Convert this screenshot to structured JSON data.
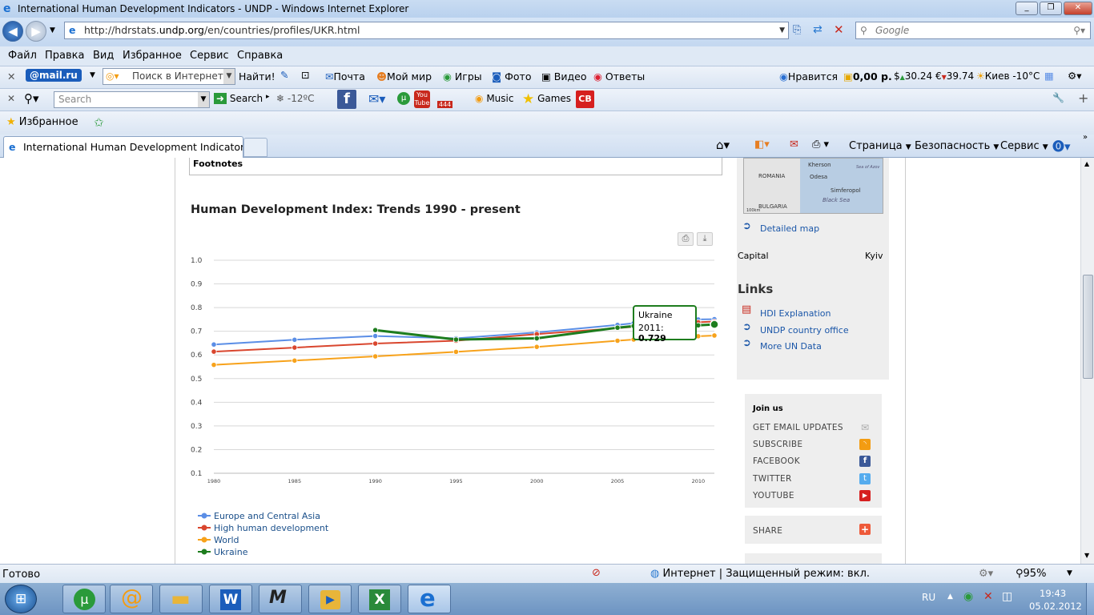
{
  "window": {
    "title": "International Human Development Indicators - UNDP - Windows Internet Explorer"
  },
  "address": {
    "url_prefix": "http://hdrstats.",
    "url_domain": "undp.org",
    "url_path": "/en/countries/profiles/UKR.html",
    "search_placeholder": "Google"
  },
  "menu": [
    "Файл",
    "Правка",
    "Вид",
    "Избранное",
    "Сервис",
    "Справка"
  ],
  "toolbar1": {
    "mailru": "@mail.ru",
    "search_placeholder": "Поиск в Интернете",
    "find": "Найти!",
    "mail": "Почта",
    "myworld": "Мой мир",
    "games": "Игры",
    "photo": "Фото",
    "video": "Видео",
    "answers": "Ответы",
    "like": "Нравится",
    "balance": "0,00 р.",
    "usd": "30.24",
    "eur": "39.74",
    "weather": "Киев -10°C"
  },
  "toolbar2": {
    "search_placeholder": "Search",
    "search_btn": "Search",
    "temp": "-12ºC",
    "badge": "444",
    "music": "Music",
    "games": "Games",
    "cb": "CB"
  },
  "favorites": {
    "label": "Избранное"
  },
  "tab": {
    "title": "International Human Development Indicators..."
  },
  "cmdbar": {
    "page": "Страница",
    "security": "Безопасность",
    "service": "Сервис"
  },
  "page": {
    "footnotes": "Footnotes",
    "chart_title": "Human Development Index: Trends 1990 - present",
    "tooltip": {
      "country": "Ukraine",
      "year": "2011:",
      "value": "0.729"
    },
    "capital_label": "Capital",
    "capital_value": "Kyiv",
    "map_link": "Detailed map",
    "map_labels": [
      "Kherson",
      "Odesa",
      "Simferopol",
      "ROMANIA",
      "BULGARIA",
      "Black Sea",
      "Sea of Azov",
      "100km"
    ],
    "links_title": "Links",
    "links": [
      "HDI Explanation",
      "UNDP country office",
      "More UN Data"
    ],
    "join_title": "Join us",
    "join": [
      "GET EMAIL UPDATES",
      "SUBSCRIBE",
      "FACEBOOK",
      "TWITTER",
      "YOUTUBE"
    ],
    "share": "SHARE"
  },
  "statusbar": {
    "left": "Готово",
    "zone": "Интернет | Защищенный режим: вкл.",
    "zoom": "95%"
  },
  "taskbar": {
    "lang": "RU",
    "time": "19:43",
    "date": "05.02.2012"
  },
  "colors": {
    "europe": "#5b8ee6",
    "high": "#d9462e",
    "world": "#f7a21b",
    "ukraine": "#1e7d1e",
    "link": "#1a56a8"
  },
  "chart_data": {
    "type": "line",
    "title": "Human Development Index: Trends 1990 - present",
    "x_ticks": [
      1980,
      1985,
      1990,
      1995,
      2000,
      2005,
      2010
    ],
    "y_ticks": [
      "1.0",
      "0.9",
      "0.8",
      "0.7",
      "0.6",
      "0.5",
      "0.4",
      "0.3",
      "0.2",
      "0.1"
    ],
    "ylim": [
      0.1,
      1.0
    ],
    "xlim": [
      1980,
      2011
    ],
    "legend_position": "bottom-left",
    "series": [
      {
        "name": "Europe and Central Asia",
        "color": "#5b8ee6",
        "x": [
          1980,
          1985,
          1990,
          1995,
          2000,
          2005,
          2006,
          2007,
          2008,
          2009,
          2010,
          2011
        ],
        "y": [
          0.644,
          0.664,
          0.68,
          0.67,
          0.695,
          0.727,
          0.734,
          0.74,
          0.745,
          0.746,
          0.75,
          0.751
        ]
      },
      {
        "name": "High human development",
        "color": "#d9462e",
        "x": [
          1980,
          1985,
          1990,
          1995,
          2000,
          2005,
          2006,
          2007,
          2008,
          2009,
          2010,
          2011
        ],
        "y": [
          0.614,
          0.631,
          0.648,
          0.66,
          0.688,
          0.713,
          0.719,
          0.725,
          0.73,
          0.732,
          0.738,
          0.741
        ]
      },
      {
        "name": "World",
        "color": "#f7a21b",
        "x": [
          1980,
          1985,
          1990,
          1995,
          2000,
          2005,
          2006,
          2007,
          2008,
          2009,
          2010,
          2011
        ],
        "y": [
          0.558,
          0.576,
          0.594,
          0.613,
          0.634,
          0.66,
          0.665,
          0.67,
          0.674,
          0.676,
          0.679,
          0.682
        ]
      },
      {
        "name": "Ukraine",
        "color": "#1e7d1e",
        "x": [
          1990,
          1995,
          2000,
          2005,
          2006,
          2007,
          2008,
          2009,
          2010,
          2011
        ],
        "y": [
          0.705,
          0.665,
          0.67,
          0.715,
          0.722,
          0.728,
          0.73,
          0.722,
          0.725,
          0.729
        ]
      }
    ]
  }
}
